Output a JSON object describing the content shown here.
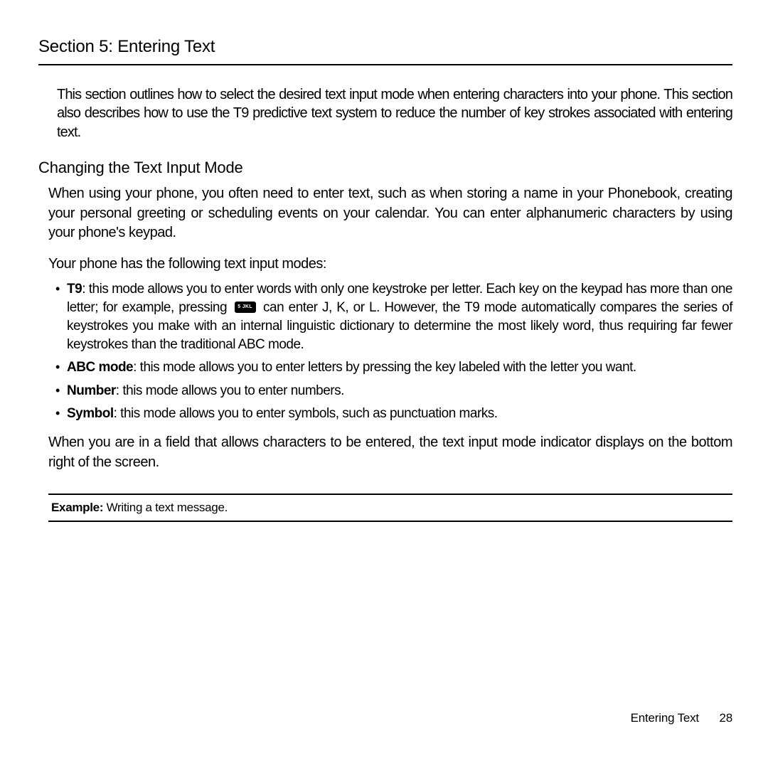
{
  "section_title": "Section 5: Entering Text",
  "lead": "This section outlines how to select the desired text input mode when entering characters into your phone. This section also describes how to use the T9 predictive text system to reduce the number of key strokes associated with entering text.",
  "subhead": "Changing the Text Input Mode",
  "para1": "When using your phone, you often need to enter text, such as when storing a name in your Phonebook, creating your personal greeting or scheduling events on your calendar. You can enter alphanumeric characters by using your phone's keypad.",
  "para2": "Your phone has the following text input modes:",
  "modes": {
    "t9": {
      "name": "T9",
      "pre": ": this mode allows you to enter words with only one keystroke per letter. Each key on the keypad has more than one letter; for example, pressing ",
      "post": " can enter J, K, or L. However, the T9 mode automatically compares the series of keystrokes you make with an internal linguistic dictionary to determine the most likely word, thus requiring far fewer keystrokes than the traditional ABC mode."
    },
    "abc": {
      "name": "ABC mode",
      "desc": ": this mode allows you to enter letters by pressing the key labeled with the letter you want."
    },
    "number": {
      "name": "Number",
      "desc": ": this mode allows you to enter numbers."
    },
    "symbol": {
      "name": "Symbol",
      "desc": ": this mode allows you to enter symbols, such as punctuation marks."
    }
  },
  "para3": "When you are in a field that allows characters to be entered, the text input mode indicator displays on the bottom right of the screen.",
  "example": {
    "label": "Example:",
    "text": " Writing a text message."
  },
  "footer": {
    "title": "Entering Text",
    "page": "28"
  }
}
